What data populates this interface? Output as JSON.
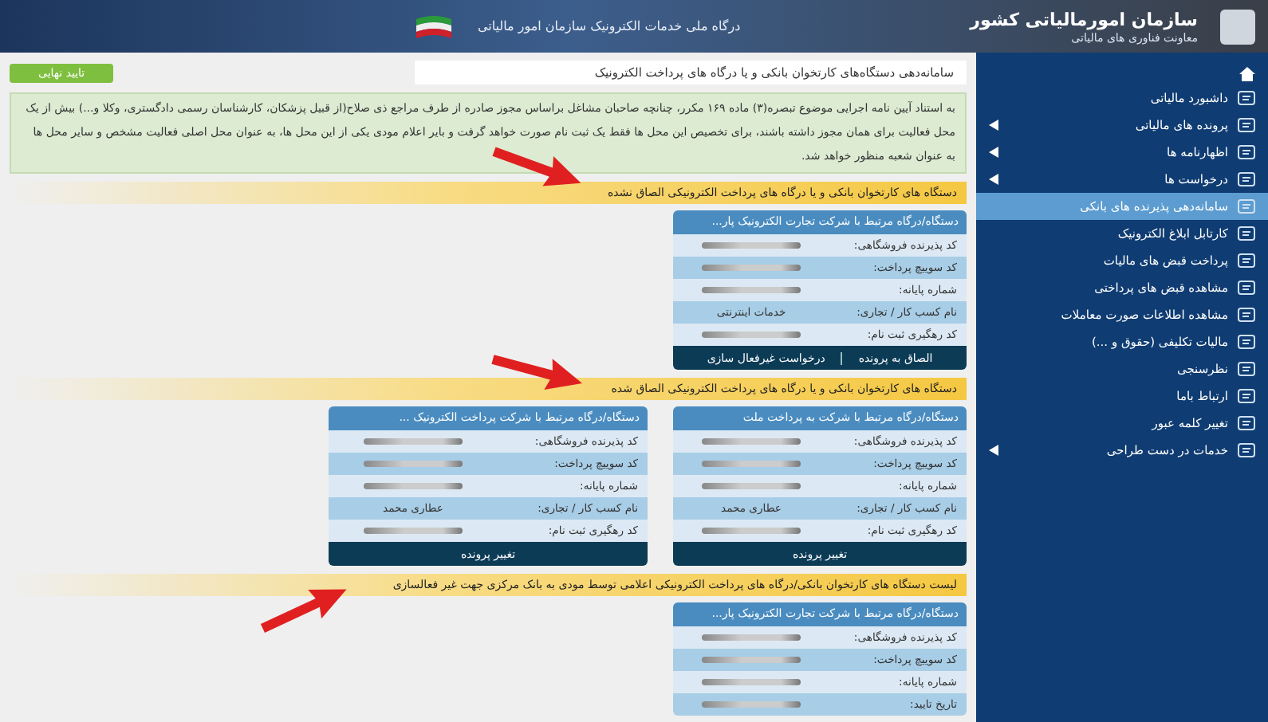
{
  "header": {
    "org_title": "سازمان امورمالیاتی کشور",
    "org_subtitle": "معاونت فناوری های مالیاتی",
    "portal_title": "درگاه ملی خدمات الکترونیک سازمان امور مالیاتی"
  },
  "page": {
    "title": "سامانه‌دهی دستگاه‌های کارتخوان بانکی و یا درگاه های پرداخت الکترونیک",
    "confirm_button": "تایید نهایی",
    "notice": "به استناد آیین نامه اجرایی موضوع تبصره(۳) ماده ۱۶۹ مکرر، چنانچه صاحبان مشاغل براساس مجوز صادره از طرف مراجع ذی صلاح(از قبیل پزشکان، کارشناسان رسمی دادگستری، وکلا و...) بیش از یک محل فعالیت برای همان مجوز داشته باشند، برای تخصیص این محل ها فقط یک ثبت نام صورت خواهد گرفت و بایر اعلام مودی یکی از این محل ها، به عنوان محل اصلی فعالیت مشخص و سایر محل ها به عنوان شعبه منظور خواهد شد."
  },
  "sections": [
    {
      "title": "دستگاه های کارتخوان بانکی و یا درگاه های پرداخت الکترونیکی الصاق نشده",
      "cards": [
        {
          "title": "دستگاه/درگاه مرتبط با شرکت تجارت الکترونیک پار...",
          "rows": [
            {
              "label": "کد پذیرنده فروشگاهی:",
              "kind": "masked"
            },
            {
              "label": "کد سوییچ پرداخت:",
              "kind": "masked"
            },
            {
              "label": "شماره پایانه:",
              "kind": "masked"
            },
            {
              "label": "نام کسب کار / تجاری:",
              "kind": "text",
              "value": "خدمات اینترنتی"
            },
            {
              "label": "کد رهگیری ثبت نام:",
              "kind": "masked"
            }
          ],
          "actions": [
            "الصاق به پرونده",
            "درخواست غیرفعال سازی"
          ]
        }
      ]
    },
    {
      "title": "دستگاه های کارتخوان بانکی و یا درگاه های پرداخت الکترونیکی الصاق شده",
      "cards": [
        {
          "title": "دستگاه/درگاه مرتبط با شرکت به پرداخت ملت",
          "rows": [
            {
              "label": "کد پذیرنده فروشگاهی:",
              "kind": "masked"
            },
            {
              "label": "کد سوییچ پرداخت:",
              "kind": "masked"
            },
            {
              "label": "شماره پایانه:",
              "kind": "masked"
            },
            {
              "label": "نام کسب کار / تجاری:",
              "kind": "text",
              "value": "عطاری محمد"
            },
            {
              "label": "کد رهگیری ثبت نام:",
              "kind": "masked"
            }
          ],
          "actions": [
            "تغییر پرونده"
          ]
        },
        {
          "title": "دستگاه/درگاه مرتبط با شرکت پرداخت الکترونیک ...",
          "rows": [
            {
              "label": "کد پذیرنده فروشگاهی:",
              "kind": "masked"
            },
            {
              "label": "کد سوییچ پرداخت:",
              "kind": "masked"
            },
            {
              "label": "شماره پایانه:",
              "kind": "masked"
            },
            {
              "label": "نام کسب کار / تجاری:",
              "kind": "text",
              "value": "عطاری محمد"
            },
            {
              "label": "کد رهگیری ثبت نام:",
              "kind": "masked"
            }
          ],
          "actions": [
            "تغییر پرونده"
          ]
        }
      ]
    },
    {
      "title": "لیست دستگاه های کارتخوان بانکی/درگاه های پرداخت الکترونیکی اعلامی توسط مودی به بانک مرکزی جهت غیر فعالسازی",
      "cards": [
        {
          "title": "دستگاه/درگاه مرتبط با شرکت تجارت الکترونیک پار...",
          "rows": [
            {
              "label": "کد پذیرنده فروشگاهی:",
              "kind": "masked"
            },
            {
              "label": "کد سوییچ پرداخت:",
              "kind": "masked"
            },
            {
              "label": "شماره پایانه:",
              "kind": "masked"
            },
            {
              "label": "تاریخ تایید:",
              "kind": "masked"
            }
          ]
        }
      ]
    }
  ],
  "sidebar": {
    "items": [
      {
        "label": "داشبورد مالیاتی",
        "submenu": false,
        "selected": false
      },
      {
        "label": "پرونده های مالیاتی",
        "submenu": true,
        "selected": false
      },
      {
        "label": "اظهارنامه ها",
        "submenu": true,
        "selected": false
      },
      {
        "label": "درخواست ها",
        "submenu": true,
        "selected": false
      },
      {
        "label": "سامانه‌دهی پذیرنده های بانکی",
        "submenu": false,
        "selected": true
      },
      {
        "label": "کارتابل ابلاغ الکترونیک",
        "submenu": false,
        "selected": false
      },
      {
        "label": "پرداخت قبض های مالیات",
        "submenu": false,
        "selected": false
      },
      {
        "label": "مشاهده قبض های پرداختی",
        "submenu": false,
        "selected": false
      },
      {
        "label": "مشاهده اطلاعات صورت معاملات",
        "submenu": false,
        "selected": false
      },
      {
        "label": "مالیات تکلیفی (حقوق و ...)",
        "submenu": false,
        "selected": false
      },
      {
        "label": "نظرسنجی",
        "submenu": false,
        "selected": false
      },
      {
        "label": "ارتباط باما",
        "submenu": false,
        "selected": false
      },
      {
        "label": "تغییر کلمه عبور",
        "submenu": false,
        "selected": false
      },
      {
        "label": "خدمات در دست طراحی",
        "submenu": true,
        "selected": false
      }
    ]
  }
}
